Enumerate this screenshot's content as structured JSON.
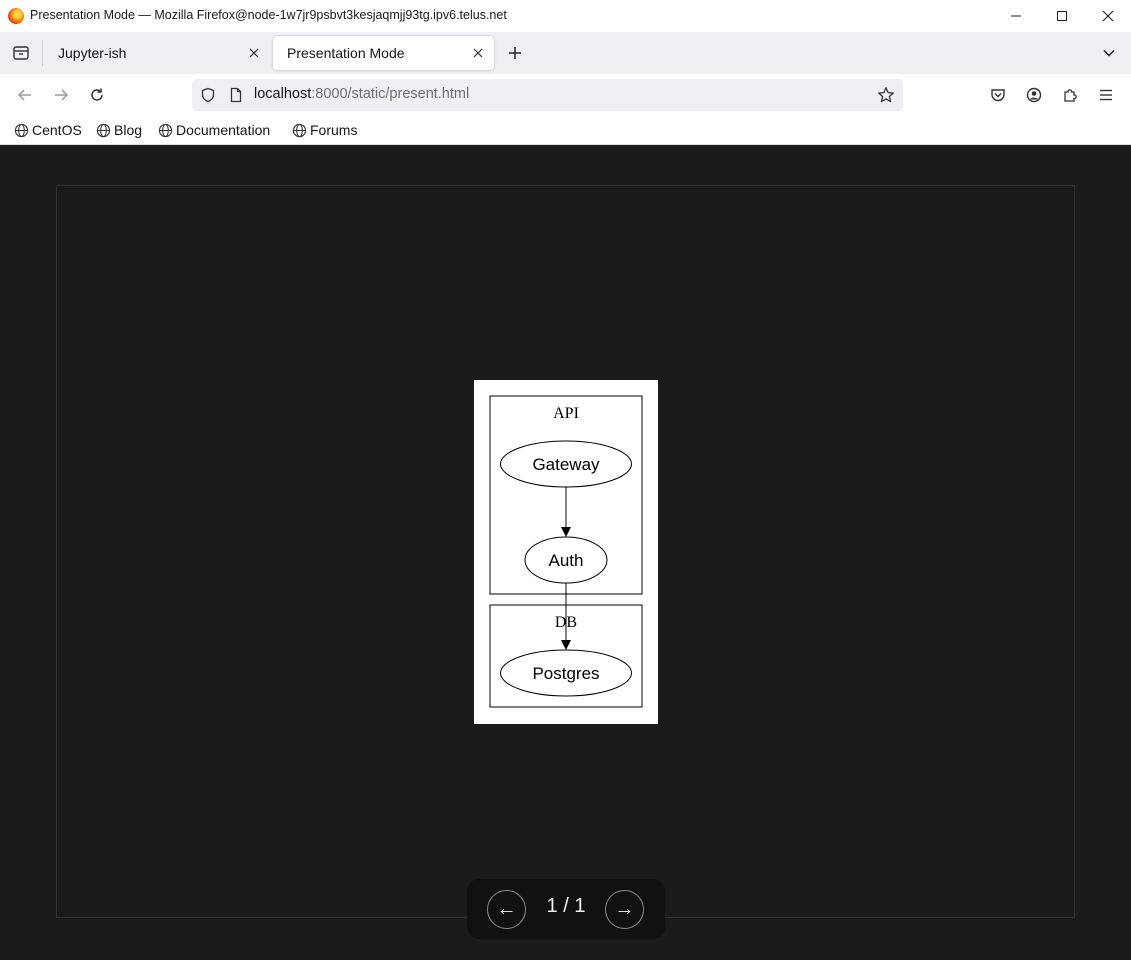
{
  "window": {
    "title": "Presentation Mode — Mozilla Firefox@node-1w7jr9psbvt3kesjaqmjj93tg.ipv6.telus.net"
  },
  "tabs": [
    {
      "label": "Jupyter-ish",
      "active": false
    },
    {
      "label": "Presentation Mode",
      "active": true
    }
  ],
  "urlbar": {
    "host": "localhost",
    "path": ":8000/static/present.html"
  },
  "bookmarks": [
    {
      "label": "CentOS"
    },
    {
      "label": "Blog"
    },
    {
      "label": "Documentation"
    },
    {
      "label": "Forums"
    }
  ],
  "diagram": {
    "clusters": [
      {
        "label": "API"
      },
      {
        "label": "DB"
      }
    ],
    "nodes": [
      {
        "label": "Gateway",
        "cluster": "API"
      },
      {
        "label": "Auth",
        "cluster": "API"
      },
      {
        "label": "Postgres",
        "cluster": "DB"
      }
    ],
    "edges": [
      {
        "from": "Gateway",
        "to": "Auth"
      },
      {
        "from": "Auth",
        "to": "Postgres"
      }
    ]
  },
  "controls": {
    "prev_label": "←",
    "next_label": "→",
    "counter": "1 / 1"
  },
  "colors": {
    "page_background": "#1b1b1b",
    "tabstrip": "#f0f0f4",
    "controls_background": "#111111"
  }
}
